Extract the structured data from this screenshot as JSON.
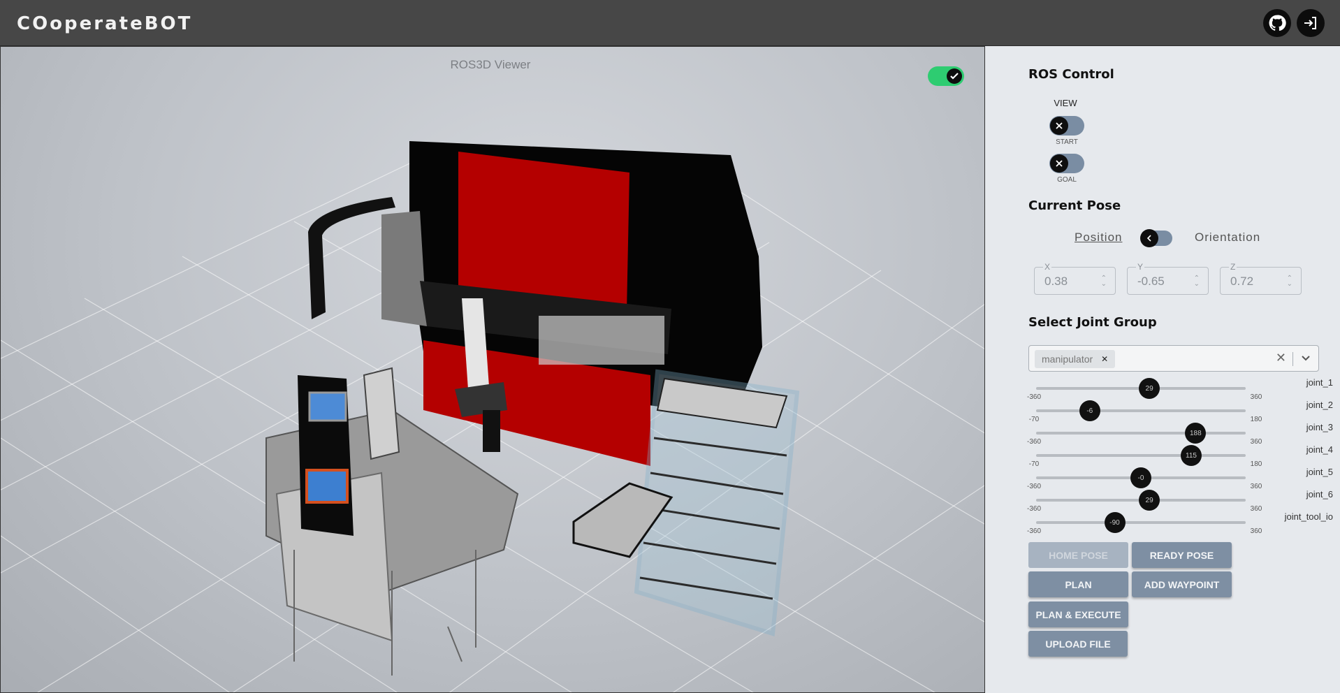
{
  "app": {
    "title": "COoperateBOT"
  },
  "header": {
    "github_label": "GitHub",
    "login_label": "Login"
  },
  "viewer": {
    "title": "ROS3D Viewer",
    "toggle_on": true
  },
  "ros_control": {
    "title": "ROS Control",
    "view_label": "VIEW",
    "start_label": "START",
    "goal_label": "GOAL"
  },
  "current_pose": {
    "title": "Current Pose",
    "position_label": "Position",
    "orientation_label": "Orientation",
    "x": {
      "label": "X",
      "value": "0.38"
    },
    "y": {
      "label": "Y",
      "value": "-0.65"
    },
    "z": {
      "label": "Z",
      "value": "0.72"
    }
  },
  "joint_group": {
    "title": "Select Joint Group",
    "selected": "manipulator",
    "joints": [
      {
        "name": "joint_1",
        "value": 29,
        "min": -360,
        "max": 360,
        "label": "29"
      },
      {
        "name": "joint_2",
        "value": -6,
        "min": -70,
        "max": 180,
        "label": "-6"
      },
      {
        "name": "joint_3",
        "value": 188,
        "min": -360,
        "max": 360,
        "label": "188"
      },
      {
        "name": "joint_4",
        "value": 115,
        "min": -70,
        "max": 180,
        "label": "115"
      },
      {
        "name": "joint_5",
        "value": 0,
        "min": -360,
        "max": 360,
        "label": "-0"
      },
      {
        "name": "joint_6",
        "value": 29,
        "min": -360,
        "max": 360,
        "label": "29"
      },
      {
        "name": "joint_tool_io",
        "value": -90,
        "min": -360,
        "max": 360,
        "label": "-90"
      }
    ]
  },
  "buttons": {
    "home_pose": "HOME POSE",
    "ready_pose": "READY POSE",
    "plan": "PLAN",
    "add_waypoint": "ADD WAYPOINT",
    "plan_execute": "PLAN & EXECUTE",
    "upload_file": "UPLOAD FILE"
  },
  "colors": {
    "header": "#474747",
    "accent_toggle": "#2ecc71",
    "button": "#7e8fa3",
    "press_red": "#b00000"
  }
}
